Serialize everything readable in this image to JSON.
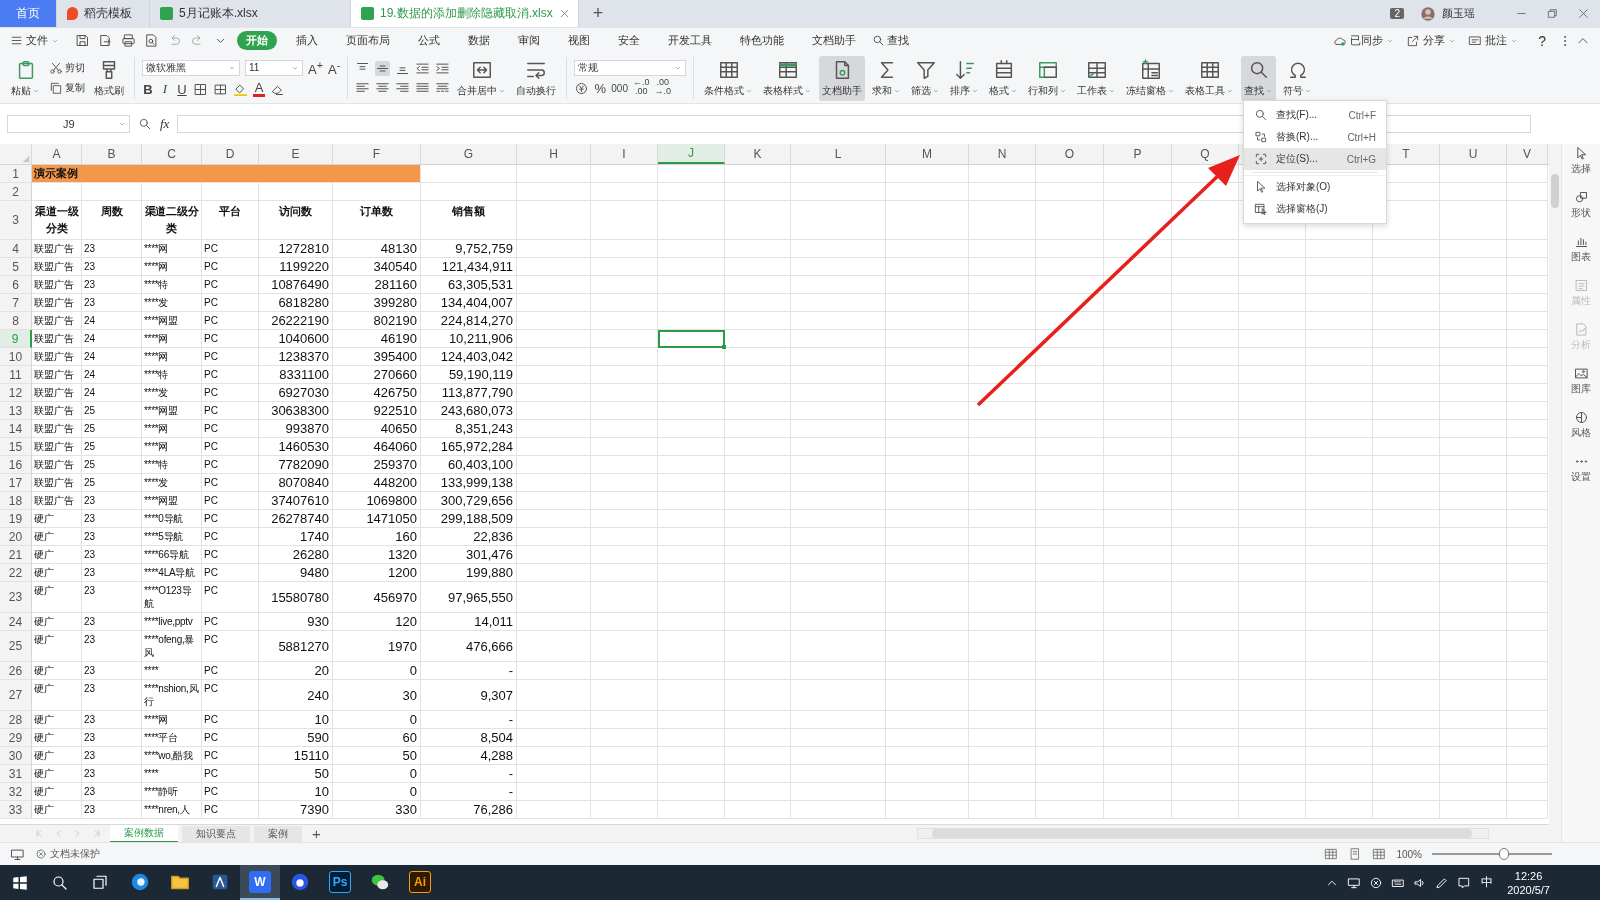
{
  "doc_tabs": [
    {
      "label": "首页",
      "kind": "home",
      "selected": false
    },
    {
      "label": "稻壳模板",
      "kind": "docer",
      "selected": false
    },
    {
      "label": "5月记账本.xlsx",
      "kind": "sheet",
      "selected": false
    },
    {
      "label": "19.数据的添加删除隐藏取消.xlsx",
      "kind": "sheet",
      "selected": true
    }
  ],
  "new_tab": "+",
  "account": {
    "badge": "2",
    "user": "颜玉瑶"
  },
  "menu": {
    "file": "文件",
    "tabs": [
      {
        "label": "开始",
        "selected": true
      },
      {
        "label": "插入",
        "selected": false
      },
      {
        "label": "页面布局",
        "selected": false
      },
      {
        "label": "公式",
        "selected": false
      },
      {
        "label": "数据",
        "selected": false
      },
      {
        "label": "审阅",
        "selected": false
      },
      {
        "label": "视图",
        "selected": false
      },
      {
        "label": "安全",
        "selected": false
      },
      {
        "label": "开发工具",
        "selected": false
      },
      {
        "label": "特色功能",
        "selected": false
      },
      {
        "label": "文档助手",
        "selected": false
      }
    ],
    "search": "查找",
    "right": [
      {
        "label": "已同步"
      },
      {
        "label": "分享"
      },
      {
        "label": "批注"
      }
    ],
    "help": "?"
  },
  "ribbon": {
    "paste": "粘贴",
    "cut": "剪切",
    "copy": "复制",
    "format_painter": "格式刷",
    "font": "微软雅黑",
    "size": "11",
    "grow": "A$^{+}$",
    "shrink": "A$^{-}$",
    "bold": "B",
    "italic": "I",
    "underline": "U",
    "font_color": "A",
    "merge": "合并居中",
    "wrap": "自动换行",
    "number_format": "常规",
    "percent": "%",
    "thousands": "000",
    "dec_inc": [
      "←.0",
      ".00"
    ],
    "dec_dec": [
      ".00",
      "→.0"
    ],
    "tools": [
      {
        "label": "条件格式",
        "pressed": false,
        "dropdown": true
      },
      {
        "label": "表格样式",
        "pressed": false,
        "dropdown": true
      },
      {
        "label": "文档助手",
        "pressed": true,
        "dropdown": false
      },
      {
        "label": "求和",
        "pressed": false,
        "dropdown": true
      },
      {
        "label": "筛选",
        "pressed": false,
        "dropdown": true
      },
      {
        "label": "排序",
        "pressed": false,
        "dropdown": true
      },
      {
        "label": "格式",
        "pressed": false,
        "dropdown": true
      },
      {
        "label": "行和列",
        "pressed": false,
        "dropdown": true
      },
      {
        "label": "工作表",
        "pressed": false,
        "dropdown": true
      },
      {
        "label": "冻结窗格",
        "pressed": false,
        "dropdown": true
      },
      {
        "label": "表格工具",
        "pressed": false,
        "dropdown": true
      },
      {
        "label": "查找",
        "pressed": true,
        "dropdown": true
      },
      {
        "label": "符号",
        "pressed": false,
        "dropdown": true
      }
    ]
  },
  "formula_bar": {
    "cell": "J9",
    "fx": "fx"
  },
  "columns": [
    {
      "letter": "A",
      "selected": false
    },
    {
      "letter": "B",
      "selected": false
    },
    {
      "letter": "C",
      "selected": false
    },
    {
      "letter": "D",
      "selected": false
    },
    {
      "letter": "E",
      "selected": false
    },
    {
      "letter": "F",
      "selected": false
    },
    {
      "letter": "G",
      "selected": false
    },
    {
      "letter": "H",
      "selected": false
    },
    {
      "letter": "I",
      "selected": false
    },
    {
      "letter": "J",
      "selected": true
    },
    {
      "letter": "K",
      "selected": false
    },
    {
      "letter": "L",
      "selected": false
    },
    {
      "letter": "M",
      "selected": false
    },
    {
      "letter": "N",
      "selected": false
    },
    {
      "letter": "O",
      "selected": false
    },
    {
      "letter": "P",
      "selected": false
    },
    {
      "letter": "Q",
      "selected": false
    }
  ],
  "columns_right": [
    {
      "letter": "T",
      "selected": false
    },
    {
      "letter": "U",
      "selected": false
    },
    {
      "letter": "V",
      "selected": false
    }
  ],
  "rows": [
    {
      "num": "1",
      "kind": "title",
      "selected": false,
      "cells": [
        "演示案例"
      ]
    },
    {
      "num": "2",
      "kind": "blank",
      "selected": false,
      "cells": []
    },
    {
      "num": "3",
      "kind": "header",
      "selected": false,
      "cells": [
        "渠道一级分类",
        "周数",
        "渠道二级分类",
        "平台",
        "访问数",
        "订单数",
        "销售额"
      ]
    },
    {
      "num": "4",
      "kind": "data",
      "selected": false,
      "cells": [
        "联盟广告",
        "23",
        "****网",
        "PC",
        "1272810",
        "48130",
        "9,752,759"
      ]
    },
    {
      "num": "5",
      "kind": "data",
      "selected": false,
      "cells": [
        "联盟广告",
        "23",
        "****网",
        "PC",
        "1199220",
        "340540",
        "121,434,911"
      ]
    },
    {
      "num": "6",
      "kind": "data",
      "selected": false,
      "cells": [
        "联盟广告",
        "23",
        "****特",
        "PC",
        "10876490",
        "281160",
        "63,305,531"
      ]
    },
    {
      "num": "7",
      "kind": "data",
      "selected": false,
      "cells": [
        "联盟广告",
        "23",
        "****发",
        "PC",
        "6818280",
        "399280",
        "134,404,007"
      ]
    },
    {
      "num": "8",
      "kind": "data",
      "selected": false,
      "cells": [
        "联盟广告",
        "24",
        "****网盟",
        "PC",
        "26222190",
        "802190",
        "224,814,270"
      ]
    },
    {
      "num": "9",
      "kind": "data",
      "selected": true,
      "cells": [
        "联盟广告",
        "24",
        "****网",
        "PC",
        "1040600",
        "46190",
        "10,211,906"
      ]
    },
    {
      "num": "10",
      "kind": "data",
      "selected": false,
      "cells": [
        "联盟广告",
        "24",
        "****网",
        "PC",
        "1238370",
        "395400",
        "124,403,042"
      ]
    },
    {
      "num": "11",
      "kind": "data",
      "selected": false,
      "cells": [
        "联盟广告",
        "24",
        "****特",
        "PC",
        "8331100",
        "270660",
        "59,190,119"
      ]
    },
    {
      "num": "12",
      "kind": "data",
      "selected": false,
      "cells": [
        "联盟广告",
        "24",
        "****发",
        "PC",
        "6927030",
        "426750",
        "113,877,790"
      ]
    },
    {
      "num": "13",
      "kind": "data",
      "selected": false,
      "cells": [
        "联盟广告",
        "25",
        "****网盟",
        "PC",
        "30638300",
        "922510",
        "243,680,073"
      ]
    },
    {
      "num": "14",
      "kind": "data",
      "selected": false,
      "cells": [
        "联盟广告",
        "25",
        "****网",
        "PC",
        "993870",
        "40650",
        "8,351,243"
      ]
    },
    {
      "num": "15",
      "kind": "data",
      "selected": false,
      "cells": [
        "联盟广告",
        "25",
        "****网",
        "PC",
        "1460530",
        "464060",
        "165,972,284"
      ]
    },
    {
      "num": "16",
      "kind": "data",
      "selected": false,
      "cells": [
        "联盟广告",
        "25",
        "****特",
        "PC",
        "7782090",
        "259370",
        "60,403,100"
      ]
    },
    {
      "num": "17",
      "kind": "data",
      "selected": false,
      "cells": [
        "联盟广告",
        "25",
        "****发",
        "PC",
        "8070840",
        "448200",
        "133,999,138"
      ]
    },
    {
      "num": "18",
      "kind": "data",
      "selected": false,
      "cells": [
        "联盟广告",
        "23",
        "****网盟",
        "PC",
        "37407610",
        "1069800",
        "300,729,656"
      ]
    },
    {
      "num": "19",
      "kind": "data",
      "selected": false,
      "cells": [
        "硬广",
        "23",
        "****0导航",
        "PC",
        "26278740",
        "1471050",
        "299,188,509"
      ]
    },
    {
      "num": "20",
      "kind": "data",
      "selected": false,
      "cells": [
        "硬广",
        "23",
        "****5导航",
        "PC",
        "1740",
        "160",
        "22,836"
      ]
    },
    {
      "num": "21",
      "kind": "data",
      "selected": false,
      "cells": [
        "硬广",
        "23",
        "****66导航",
        "PC",
        "26280",
        "1320",
        "301,476"
      ]
    },
    {
      "num": "22",
      "kind": "data",
      "selected": false,
      "cells": [
        "硬广",
        "23",
        "****4LA导航",
        "PC",
        "9480",
        "1200",
        "199,880"
      ]
    },
    {
      "num": "23",
      "kind": "data",
      "selected": false,
      "cells": [
        "硬广",
        "23",
        "****O123导航",
        "PC",
        "15580780",
        "456970",
        "97,965,550"
      ]
    },
    {
      "num": "24",
      "kind": "data",
      "selected": false,
      "cells": [
        "硬广",
        "23",
        "****live,pptv",
        "PC",
        "930",
        "120",
        "14,011"
      ]
    },
    {
      "num": "25",
      "kind": "data",
      "selected": false,
      "cells": [
        "硬广",
        "23",
        "****ofeng,暴风",
        "PC",
        "5881270",
        "1970",
        "476,666"
      ]
    },
    {
      "num": "26",
      "kind": "data",
      "selected": false,
      "cells": [
        "硬广",
        "23",
        "****",
        "PC",
        "20",
        "0",
        "-"
      ]
    },
    {
      "num": "27",
      "kind": "data",
      "selected": false,
      "cells": [
        "硬广",
        "23",
        "****nshion,风行",
        "PC",
        "240",
        "30",
        "9,307"
      ]
    },
    {
      "num": "28",
      "kind": "data",
      "selected": false,
      "cells": [
        "硬广",
        "23",
        "****网",
        "PC",
        "10",
        "0",
        "-"
      ]
    },
    {
      "num": "29",
      "kind": "data",
      "selected": false,
      "cells": [
        "硬广",
        "23",
        "****平台",
        "PC",
        "590",
        "60",
        "8,504"
      ]
    },
    {
      "num": "30",
      "kind": "data",
      "selected": false,
      "cells": [
        "硬广",
        "23",
        "****wo,酷我",
        "PC",
        "15110",
        "50",
        "4,288"
      ]
    },
    {
      "num": "31",
      "kind": "data",
      "selected": false,
      "cells": [
        "硬广",
        "23",
        "****",
        "PC",
        "50",
        "0",
        "-"
      ]
    },
    {
      "num": "32",
      "kind": "data",
      "selected": false,
      "cells": [
        "硬广",
        "23",
        "****静听",
        "PC",
        "10",
        "0",
        "-"
      ]
    },
    {
      "num": "33",
      "kind": "data",
      "selected": false,
      "cells": [
        "硬广",
        "23",
        "****nren,人",
        "PC",
        "7390",
        "330",
        "76,286"
      ]
    }
  ],
  "find_menu": [
    {
      "label": "查找(F)...",
      "shortcut": "Ctrl+F",
      "highlighted": false
    },
    {
      "label": "替换(R)...",
      "shortcut": "Ctrl+H",
      "highlighted": false
    },
    {
      "label": "定位(S)...",
      "shortcut": "Ctrl+G",
      "highlighted": true
    },
    {
      "label": "选择对象(O)",
      "highlighted": false,
      "separated": true
    },
    {
      "label": "选择窗格(J)",
      "highlighted": false
    }
  ],
  "side_panel": [
    {
      "label": "选择",
      "disabled": false
    },
    {
      "label": "形状",
      "disabled": false
    },
    {
      "label": "图表",
      "disabled": false
    },
    {
      "label": "属性",
      "disabled": true
    },
    {
      "label": "分析",
      "disabled": true
    },
    {
      "label": "图库",
      "disabled": false
    },
    {
      "label": "风格",
      "disabled": false
    },
    {
      "label": "设置",
      "disabled": false
    }
  ],
  "sheet_tabs": [
    {
      "label": "案例数据",
      "selected": true
    },
    {
      "label": "知识要点",
      "selected": false
    },
    {
      "label": "案例",
      "selected": false
    }
  ],
  "add_sheet": "+",
  "status": {
    "protection": "文档未保护",
    "zoom": "100%",
    "zoom_slider": {
      "level": 0.6
    }
  },
  "taskbar": {
    "apps": [
      {
        "kind": "edge",
        "active": false
      },
      {
        "kind": "folder",
        "active": false
      },
      {
        "kind": "app",
        "active": false
      },
      {
        "kind": "wps",
        "label": "W",
        "active": true
      },
      {
        "kind": "baidu",
        "active": false
      },
      {
        "kind": "ps",
        "label": "Ps",
        "active": false
      },
      {
        "kind": "wechat",
        "active": false
      },
      {
        "kind": "ai",
        "label": "Ai",
        "active": false
      }
    ],
    "ime": "中",
    "time": "12:26",
    "date": "2020/5/7"
  }
}
